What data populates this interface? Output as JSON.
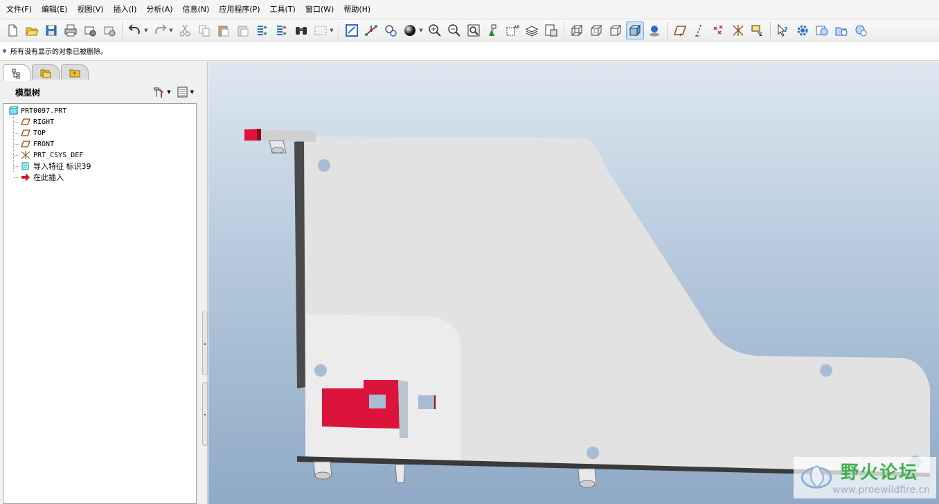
{
  "menu": {
    "items": [
      "文件(F)",
      "编辑(E)",
      "视图(V)",
      "插入(I)",
      "分析(A)",
      "信息(N)",
      "应用程序(P)",
      "工具(T)",
      "窗口(W)",
      "帮助(H)"
    ]
  },
  "toolbar": {
    "groups": [
      [
        "new-icon",
        "open-icon",
        "save-icon",
        "print-icon",
        "email-icon",
        "email-link-icon"
      ],
      [
        "undo-icon",
        "redo-icon",
        "cut-icon",
        "copy-icon",
        "paste-icon",
        "paste-special-icon",
        "regenerate-icon",
        "regen-manager-icon",
        "find-icon",
        "select-box-icon"
      ],
      [
        "repaint-icon",
        "spin-center-icon",
        "orient-mode-icon",
        "appearance-icon",
        "zoom-in-icon",
        "zoom-out-icon",
        "refit-icon",
        "reorient-icon",
        "saved-views-icon",
        "layers-icon",
        "view-manager-icon"
      ],
      [
        "wireframe-icon",
        "hidden-line-icon",
        "no-hidden-icon",
        "shading-icon",
        "enhanced-realism-icon"
      ],
      [
        "datum-planes-icon",
        "datum-axes-icon",
        "datum-points-icon",
        "csys-icon",
        "annotations-icon"
      ],
      [
        "context-help-icon",
        "settings-icon",
        "model-tree-settings-icon",
        "folder-browser-icon",
        "web-icon"
      ]
    ],
    "pressed": "shading-icon"
  },
  "message": {
    "text": "所有没有显示的对象已被删除。"
  },
  "navigator": {
    "tabs": [
      "model-tree-tab-icon",
      "folder-tab-icon",
      "favorites-tab-icon"
    ],
    "active_tab": 0
  },
  "model_tree": {
    "title": "模型树",
    "root": "PRT0097.PRT",
    "items": [
      {
        "label": "RIGHT",
        "icon": "datum-plane-icon"
      },
      {
        "label": "TOP",
        "icon": "datum-plane-icon"
      },
      {
        "label": "FRONT",
        "icon": "datum-plane-icon"
      },
      {
        "label": "PRT_CSYS_DEF",
        "icon": "csys-icon"
      },
      {
        "label": "导入特征 标识39",
        "icon": "import-feature-icon"
      },
      {
        "label": "在此插入",
        "icon": "insert-here-arrow-icon"
      }
    ]
  },
  "viewport": {
    "background_top": "#dde7f0",
    "background_bottom": "#8fa9c6",
    "part_color": "#dcdcdc",
    "highlight_color": "#dc143c"
  },
  "watermark": {
    "name": "野火论坛",
    "url": "www.proewildfire.cn"
  }
}
